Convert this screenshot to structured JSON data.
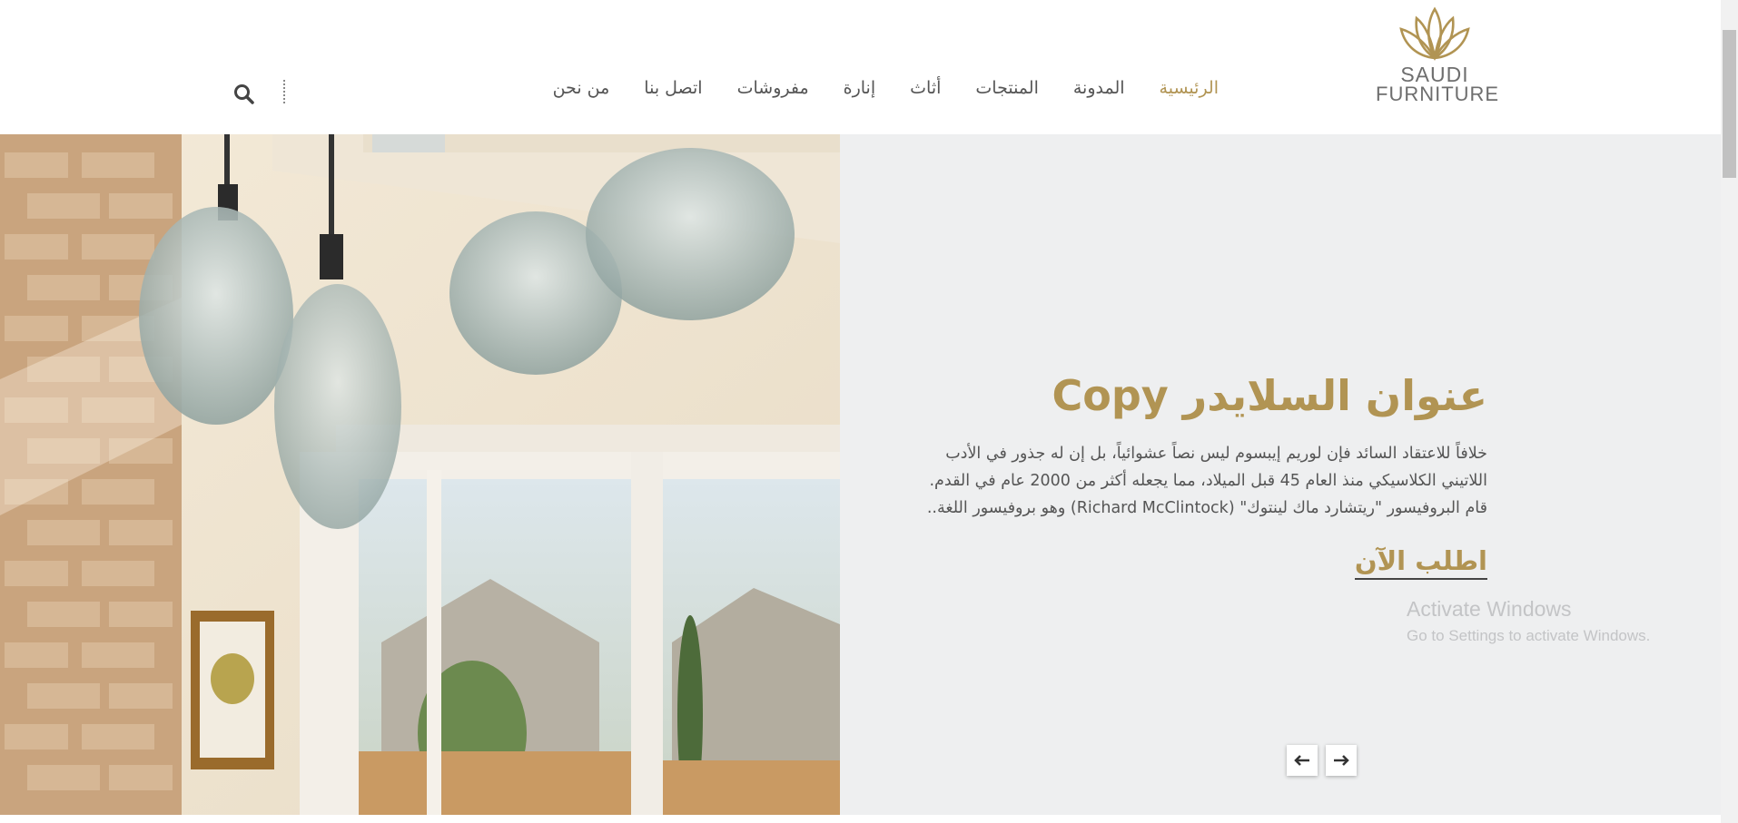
{
  "logo": {
    "line1": "SAUDI",
    "line2": "FURNITURE"
  },
  "nav": {
    "items": [
      {
        "label": "الرئيسية",
        "active": true
      },
      {
        "label": "المدونة"
      },
      {
        "label": "المنتجات"
      },
      {
        "label": "أثاث"
      },
      {
        "label": "إنارة"
      },
      {
        "label": "مفروشات"
      },
      {
        "label": "اتصل بنا"
      },
      {
        "label": "من نحن"
      }
    ],
    "search_icon": "search-icon"
  },
  "hero": {
    "title": "عنوان السلايدر Copy",
    "desc_line1": "خلافاً للاعتقاد السائد فإن لوريم إيبسوم ليس نصاً عشوائياً، بل إن له جذور في الأدب",
    "desc_line2": "اللاتيني الكلاسيكي منذ العام 45 قبل الميلاد، مما يجعله أكثر من 2000 عام في القدم.",
    "desc_line3": "قام البروفيسور \"ريتشارد ماك لينتوك\" (Richard McClintock) وهو بروفيسور اللغة..",
    "cta": "اطلب الآن"
  },
  "slider": {
    "prev_icon": "arrow-left-icon",
    "next_icon": "arrow-right-icon"
  },
  "watermark": {
    "title": "Activate Windows",
    "subtitle": "Go to Settings to activate Windows."
  },
  "colors": {
    "accent": "#b19453",
    "nav_text": "#555555",
    "hero_bg": "#eeeff0"
  }
}
